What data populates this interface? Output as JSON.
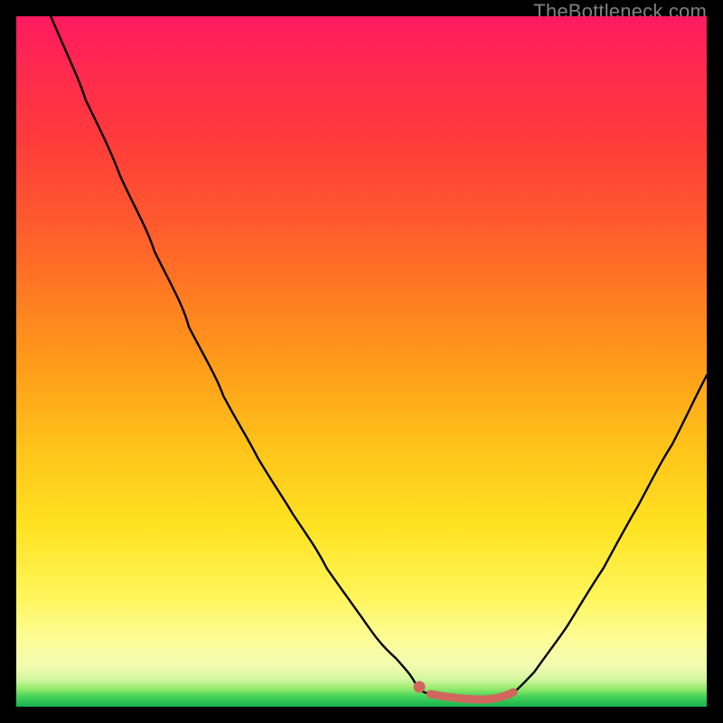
{
  "watermark": {
    "text": "TheBottleneck.com"
  },
  "colors": {
    "background": "#000000",
    "curve": "#000000",
    "marker": "#d1665f",
    "trough_line": "#d1665f"
  },
  "chart_data": {
    "type": "line",
    "title": "",
    "xlabel": "",
    "ylabel": "",
    "xlim": [
      0,
      100
    ],
    "ylim": [
      0,
      100
    ],
    "grid": false,
    "legend": false,
    "description": "Bottleneck curve: y is bottleneck % (100=worst at top, 0=best at bottom) across an implied x scan. V-shape with minimum near x≈60–72.",
    "series": [
      {
        "name": "bottleneck-curve",
        "x": [
          5,
          10,
          15,
          20,
          25,
          30,
          35,
          40,
          45,
          50,
          55,
          58,
          60,
          65,
          70,
          72,
          75,
          80,
          85,
          90,
          95,
          100
        ],
        "y": [
          100,
          88,
          77,
          66,
          55,
          45,
          36,
          28,
          20,
          13,
          7,
          3,
          2,
          1,
          1,
          2,
          5,
          12,
          20,
          29,
          38,
          48
        ]
      }
    ],
    "trough": {
      "x_start": 60,
      "x_end": 72,
      "y": 1.5
    },
    "marker": {
      "x": 58,
      "y": 3
    }
  }
}
